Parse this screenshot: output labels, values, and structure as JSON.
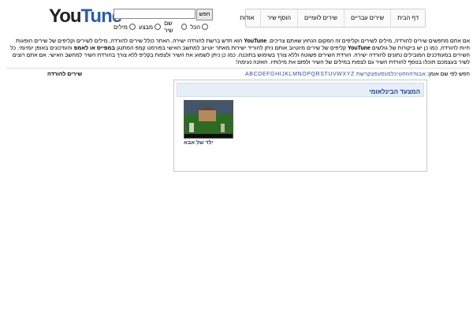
{
  "header": {
    "logo_you": "You",
    "logo_tune": "Tune",
    "search_button": "חפש",
    "search_value": "",
    "radio_options": [
      "הכל",
      "שם שיר",
      "מבצע",
      "מילים"
    ]
  },
  "nav": {
    "items": [
      "דף הבית",
      "שירים עבריים",
      "שירים לועזיים",
      "הוסף שיר",
      "אודות"
    ]
  },
  "intro": {
    "text_1": "אם אתם מחפשים שירים להורדה, מילים לשירים וקליפים זה המקום הנחוץ שאתם צריכים. ",
    "bold_1": "YouTune",
    "text_2": " הוא חדש ברשת להורדה ישירה, האתר כולל שירים להורדה, מילים לשירים וקליפים של שירים הופעות חיות להורדה, כמו כן יש ביקורות של גולשים ",
    "bold_2": "YouTune",
    "text_3": " קליפים של שירים מיוטיוב אותם ניתן להוריד ישירות מאתר יוטיוב למחשב האישי בפורמט קמפ המתנגן ",
    "bold_3": "במפייס או לאמפ",
    "text_4": " והעדכונים באופן יומיומי. כל השירים במעודכנים המובילים נתונים להורדה ישירה. הורדת השירים פשוטה וללא צורך בשימוש בתוכנה. כמו כן ניתן לשמוע את השיר ולצפות בקליפ ללא צורך בהורדת השיר למחשב האישי. אם אתם רוצים לשיר בעצמכם תוכלו בנוסף להורדת השיר גם לצפות במילים של השיר ולפזם את מילותיו. האזנה נעימה!"
  },
  "alphabet": {
    "label": "חפש לפי שם אומן:",
    "hebrew": "אבגדהוזחטיכלמנסעפצקרשת",
    "english": "ABCDEFGHIJKLMNOPQRSTUVWXYZ"
  },
  "sidebar": {
    "title": "שירים להורדה"
  },
  "panel": {
    "title": "המצעד הבינלאומי",
    "song_title": "ילד של אבא"
  }
}
